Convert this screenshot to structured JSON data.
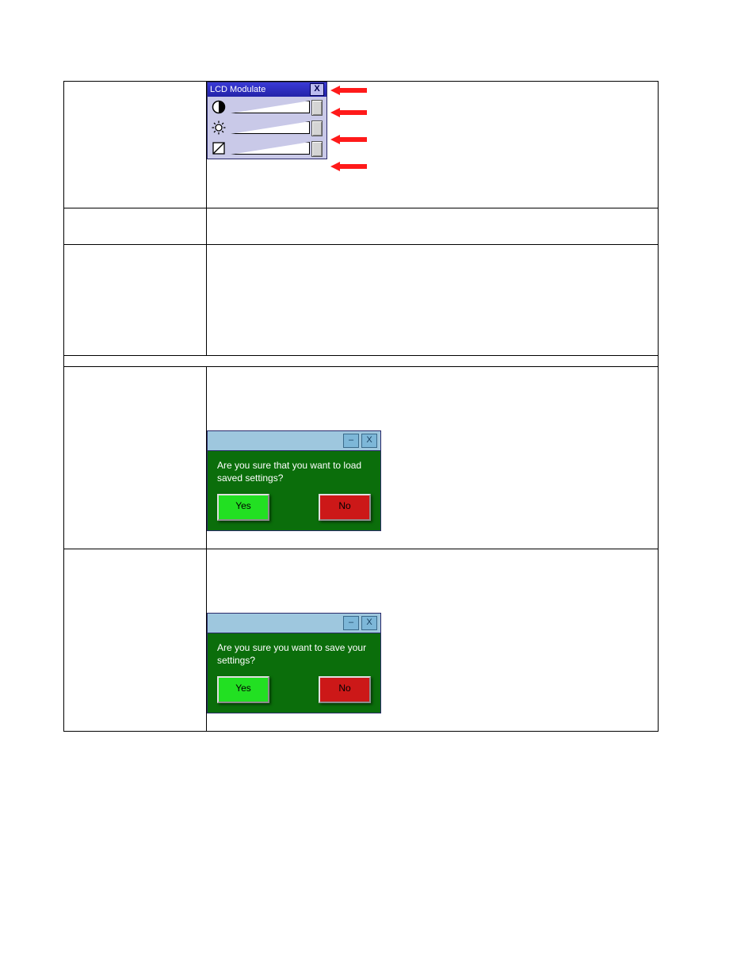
{
  "lcd_panel": {
    "title": "LCD Modulate",
    "close_label": "X",
    "rows": [
      {
        "icon": "contrast-icon"
      },
      {
        "icon": "brightness-icon"
      },
      {
        "icon": "calibration-icon"
      }
    ]
  },
  "title_buttons": {
    "minimize": "–",
    "close": "X"
  },
  "dialog_load": {
    "message": "Are you sure that you want to load saved settings?",
    "yes": "Yes",
    "no": "No"
  },
  "dialog_save": {
    "message": "Are you sure you want to save your settings?",
    "yes": "Yes",
    "no": "No"
  }
}
